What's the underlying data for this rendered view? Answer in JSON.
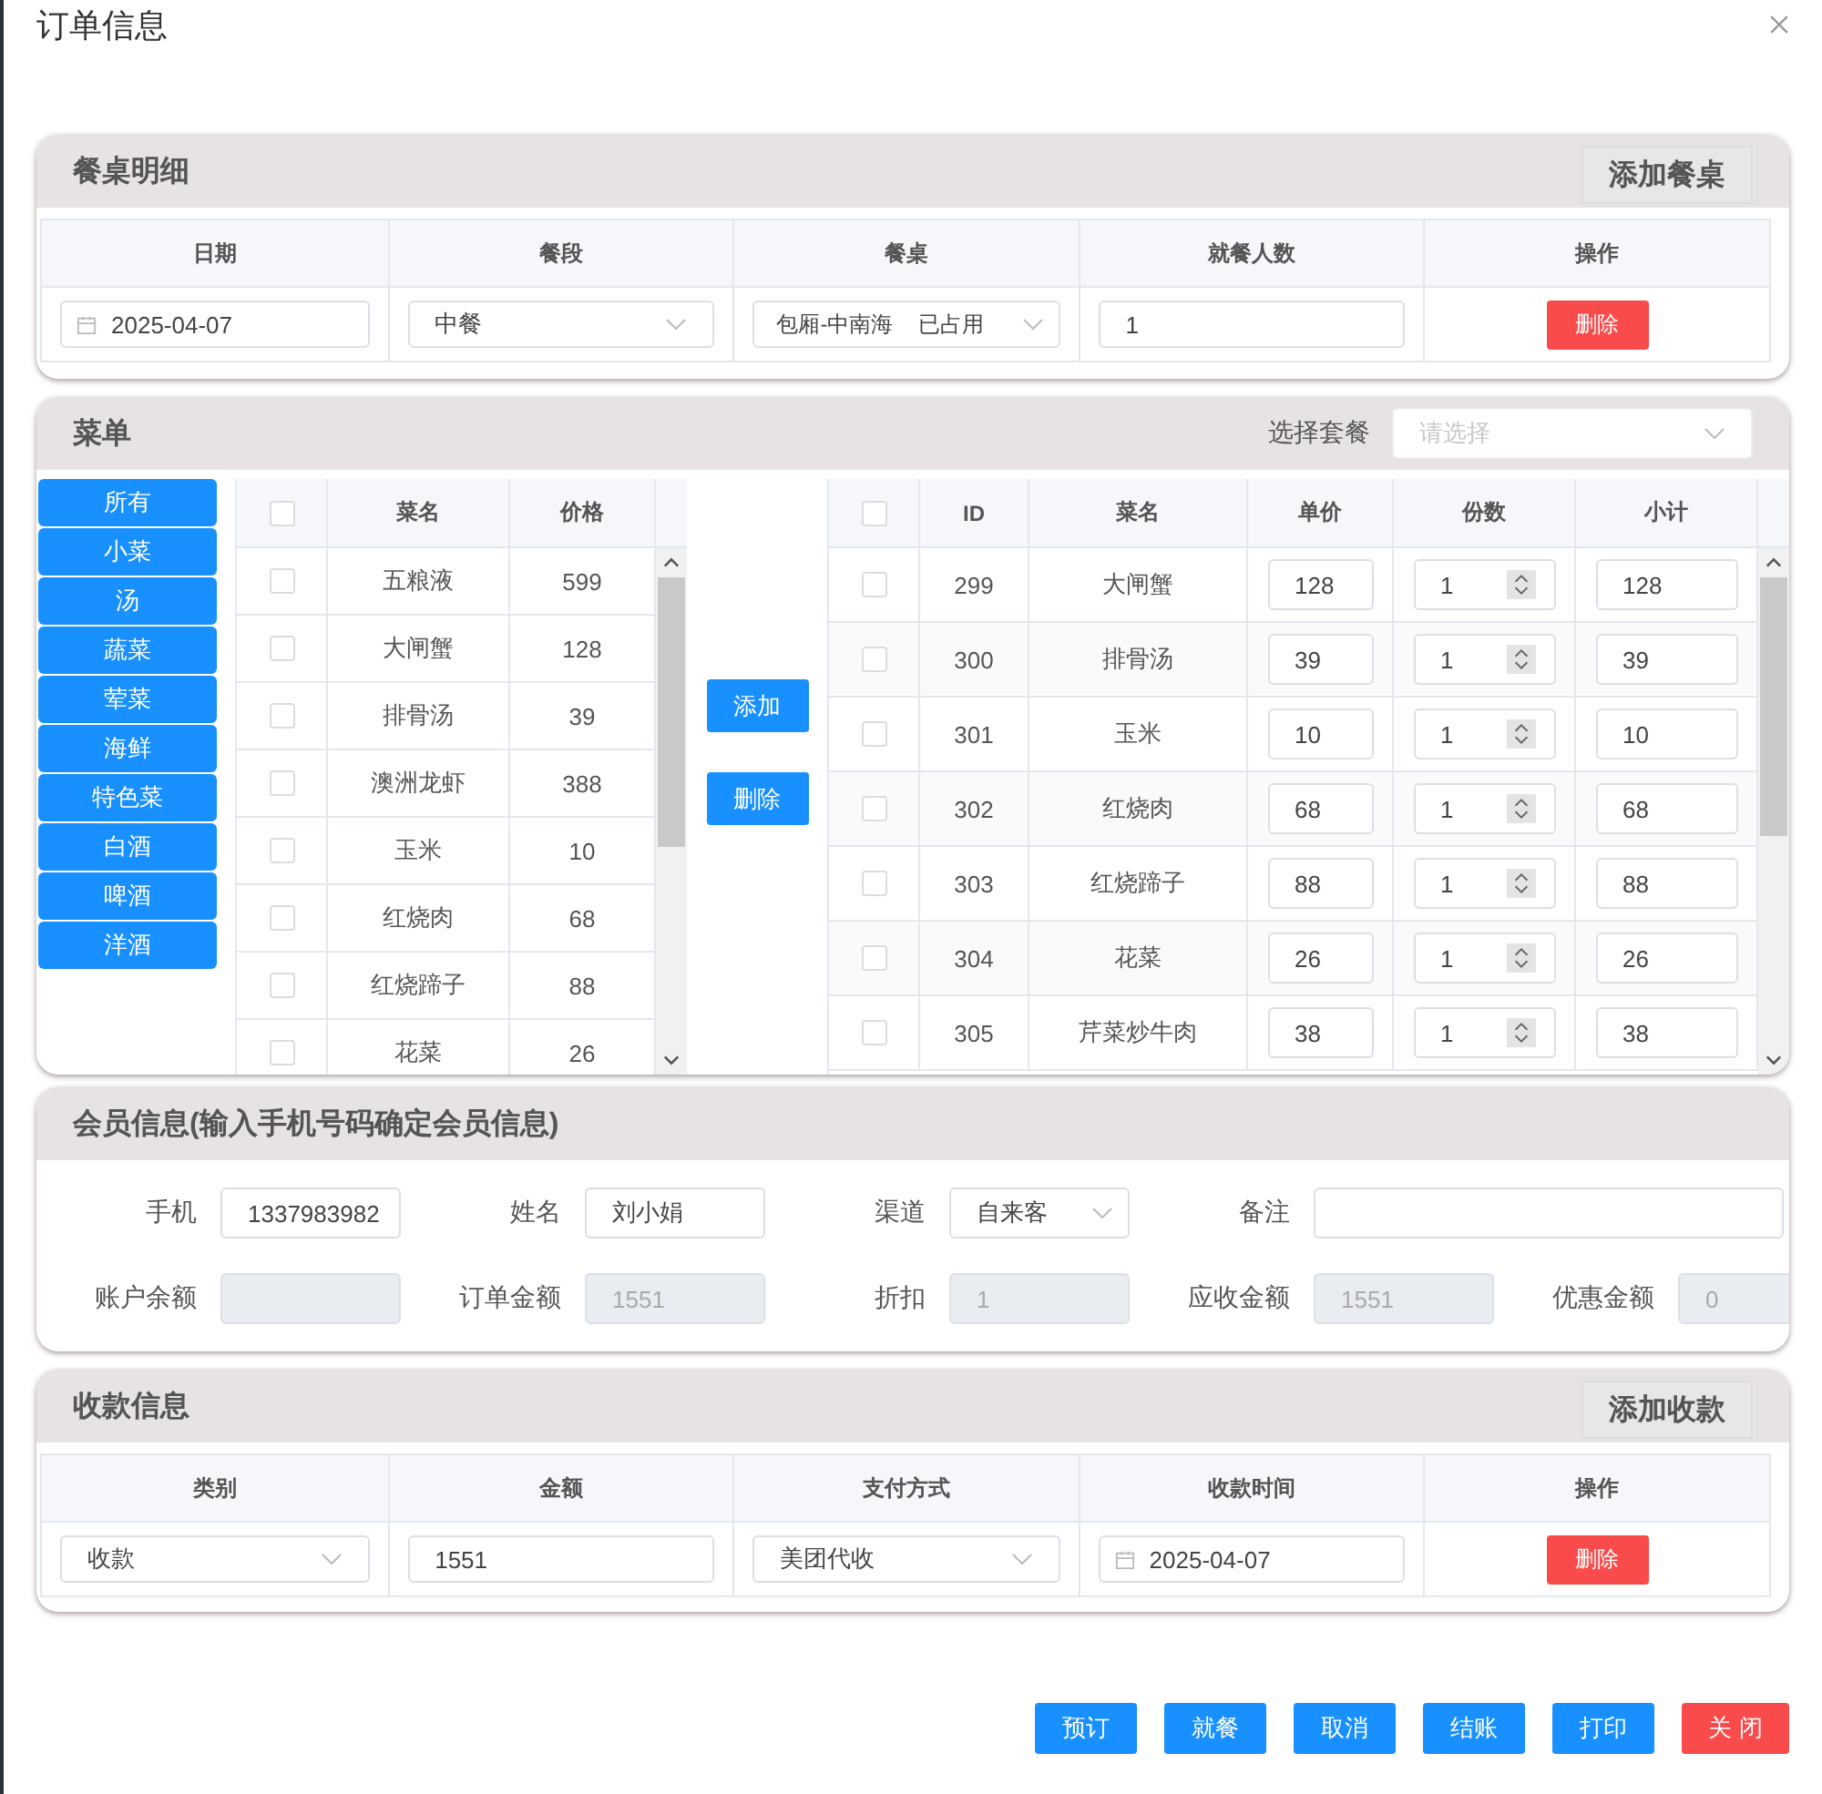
{
  "dialog": {
    "title": "订单信息"
  },
  "table_section": {
    "title": "餐桌明细",
    "add_button": "添加餐桌",
    "columns": [
      "日期",
      "餐段",
      "餐桌",
      "就餐人数",
      "操作"
    ],
    "rows": [
      {
        "date": "2025-04-07",
        "period": "中餐",
        "table": "包厢-中南海",
        "table_status": "已占用",
        "guests": "1",
        "action": "删除"
      }
    ]
  },
  "menu_section": {
    "title": "菜单",
    "package_label": "选择套餐",
    "package_placeholder": "请选择",
    "categories": [
      "所有",
      "小菜",
      "汤",
      "蔬菜",
      "荤菜",
      "海鲜",
      "特色菜",
      "白酒",
      "啤酒",
      "洋酒"
    ],
    "dish_list": {
      "all_checked": false,
      "columns": [
        "菜名",
        "价格"
      ],
      "rows": [
        {
          "name": "五粮液",
          "price": "599",
          "checked": false
        },
        {
          "name": "大闸蟹",
          "price": "128",
          "checked": false
        },
        {
          "name": "排骨汤",
          "price": "39",
          "checked": false
        },
        {
          "name": "澳洲龙虾",
          "price": "388",
          "checked": false
        },
        {
          "name": "玉米",
          "price": "10",
          "checked": false
        },
        {
          "name": "红烧肉",
          "price": "68",
          "checked": false
        },
        {
          "name": "红烧蹄子",
          "price": "88",
          "checked": false
        },
        {
          "name": "花菜",
          "price": "26",
          "checked": false
        }
      ]
    },
    "add_button": "添加",
    "remove_button": "删除",
    "order_items": {
      "all_checked": false,
      "columns": [
        "ID",
        "菜名",
        "单价",
        "份数",
        "小计"
      ],
      "rows": [
        {
          "id": "299",
          "name": "大闸蟹",
          "unit_price": "128",
          "quantity": "1",
          "subtotal": "128",
          "checked": false
        },
        {
          "id": "300",
          "name": "排骨汤",
          "unit_price": "39",
          "quantity": "1",
          "subtotal": "39",
          "checked": false
        },
        {
          "id": "301",
          "name": "玉米",
          "unit_price": "10",
          "quantity": "1",
          "subtotal": "10",
          "checked": false
        },
        {
          "id": "302",
          "name": "红烧肉",
          "unit_price": "68",
          "quantity": "1",
          "subtotal": "68",
          "checked": false
        },
        {
          "id": "303",
          "name": "红烧蹄子",
          "unit_price": "88",
          "quantity": "1",
          "subtotal": "88",
          "checked": false
        },
        {
          "id": "304",
          "name": "花菜",
          "unit_price": "26",
          "quantity": "1",
          "subtotal": "26",
          "checked": false
        },
        {
          "id": "305",
          "name": "芹菜炒牛肉",
          "unit_price": "38",
          "quantity": "1",
          "subtotal": "38",
          "checked": false
        }
      ]
    }
  },
  "member_section": {
    "title": "会员信息(输入手机号码确定会员信息)",
    "fields": [
      {
        "label": "手机",
        "value": "1337983982",
        "kind": "input",
        "disabled": false
      },
      {
        "label": "姓名",
        "value": "刘小娟",
        "kind": "input",
        "disabled": false
      },
      {
        "label": "渠道",
        "value": "自来客",
        "kind": "select",
        "disabled": false
      },
      {
        "label": "备注",
        "kind": "wide",
        "disabled": false
      },
      {
        "label": "账户余额",
        "kind": "input",
        "disabled": true
      },
      {
        "label": "订单金额",
        "value": "1551",
        "kind": "input",
        "disabled": true
      },
      {
        "label": "折扣",
        "value": "1",
        "kind": "input",
        "disabled": true
      },
      {
        "label": "应收金额",
        "value": "1551",
        "kind": "input",
        "disabled": true
      },
      {
        "label": "优惠金额",
        "value": "0",
        "kind": "input",
        "disabled": true
      }
    ]
  },
  "payment_section": {
    "title": "收款信息",
    "add_button": "添加收款",
    "columns": [
      "类别",
      "金额",
      "支付方式",
      "收款时间",
      "操作"
    ],
    "rows": [
      {
        "category": "收款",
        "amount": "1551",
        "method": "美团代收",
        "time": "2025-04-07",
        "action": "删除"
      }
    ]
  },
  "actions": [
    {
      "label": "预订",
      "kind": "primary"
    },
    {
      "label": "就餐",
      "kind": "primary"
    },
    {
      "label": "取消",
      "kind": "primary"
    },
    {
      "label": "结账",
      "kind": "primary"
    },
    {
      "label": "打印",
      "kind": "primary"
    },
    {
      "label": "关 闭",
      "kind": "danger"
    }
  ]
}
